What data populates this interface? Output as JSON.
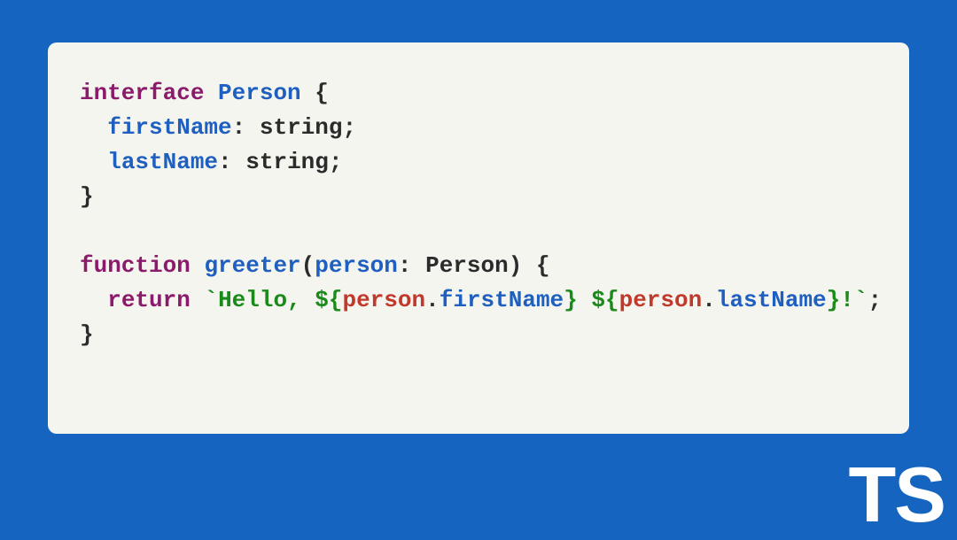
{
  "logo": "TS",
  "code": {
    "line1": {
      "kw": "interface",
      "name": "Person",
      "open": " {"
    },
    "line2": {
      "indent": "  ",
      "prop": "firstName",
      "colon": ": ",
      "type": "string",
      "semi": ";"
    },
    "line3": {
      "indent": "  ",
      "prop": "lastName",
      "colon": ": ",
      "type": "string",
      "semi": ";"
    },
    "line4": {
      "close": "}"
    },
    "line5": {
      "blank": ""
    },
    "line6": {
      "kw": "function",
      "name": "greeter",
      "open": "(",
      "param": "person",
      "colon": ": ",
      "ptype": "Person",
      "close": ") {"
    },
    "line7": {
      "indent": "  ",
      "kw": "return",
      "tick1": " `",
      "str1": "Hello, ",
      "dopen1": "${",
      "obj1": "person",
      "dot1": ".",
      "prop1": "firstName",
      "dclose1": "}",
      "str2": " ",
      "dopen2": "${",
      "obj2": "person",
      "dot2": ".",
      "prop2": "lastName",
      "dclose2": "}",
      "str3": "!",
      "tick2": "`",
      "semi": ";"
    },
    "line8": {
      "close": "}"
    }
  }
}
